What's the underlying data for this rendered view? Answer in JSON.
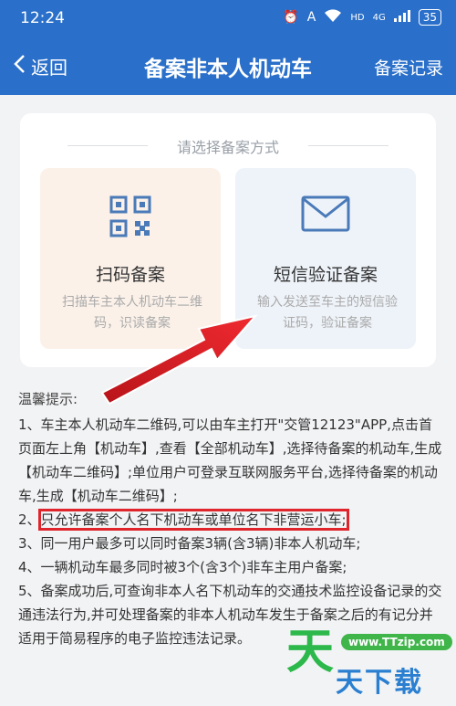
{
  "status_bar": {
    "time": "12:24",
    "signal_labels": [
      "HD",
      "4G"
    ],
    "battery": "35"
  },
  "nav": {
    "back_label": "返回",
    "title": "备案非本人机动车",
    "right_label": "备案记录"
  },
  "method_panel": {
    "heading": "请选择备案方式",
    "options": [
      {
        "icon": "qr-code-icon",
        "title": "扫码备案",
        "description": "扫描车主本人机动车二维码，识读备案"
      },
      {
        "icon": "envelope-icon",
        "title": "短信验证备案",
        "description": "输入发送至车主的短信验证码，验证备案"
      }
    ]
  },
  "notes": {
    "heading": "温馨提示:",
    "items": [
      "1、车主本人机动车二维码,可以由车主打开\"交管12123\"APP,点击首页面左上角【机动车】,查看【全部机动车】,选择待备案的机动车,生成【机动车二维码】;单位用户可登录互联网服务平台,选择待备案的机动车,生成【机动车二维码】;",
      "只允许备案个人名下机动车或单位名下非营运小车;",
      "3、同一用户最多可以同时备案3辆(含3辆)非本人机动车;",
      "4、一辆机动车最多同时被3个(含3个)非车主用户备案;",
      "5、备案成功后,可查询非本人名下机动车的交通技术监控设备记录的交通违法行为,并可处理备案的非本人机动车发生于备案之后的有记分并适用于简易程序的电子监控违法记录。"
    ],
    "item2_prefix": "2、"
  },
  "watermark": {
    "logo_char": "天",
    "badge": "www.TTzip.com",
    "text": "天下载"
  },
  "colors": {
    "nav_bg": "#2a6fc9",
    "highlight": "#e0242b",
    "arrow": "#e0242b",
    "scan_card": "#fbf1e9",
    "sms_card": "#eef3f9"
  }
}
